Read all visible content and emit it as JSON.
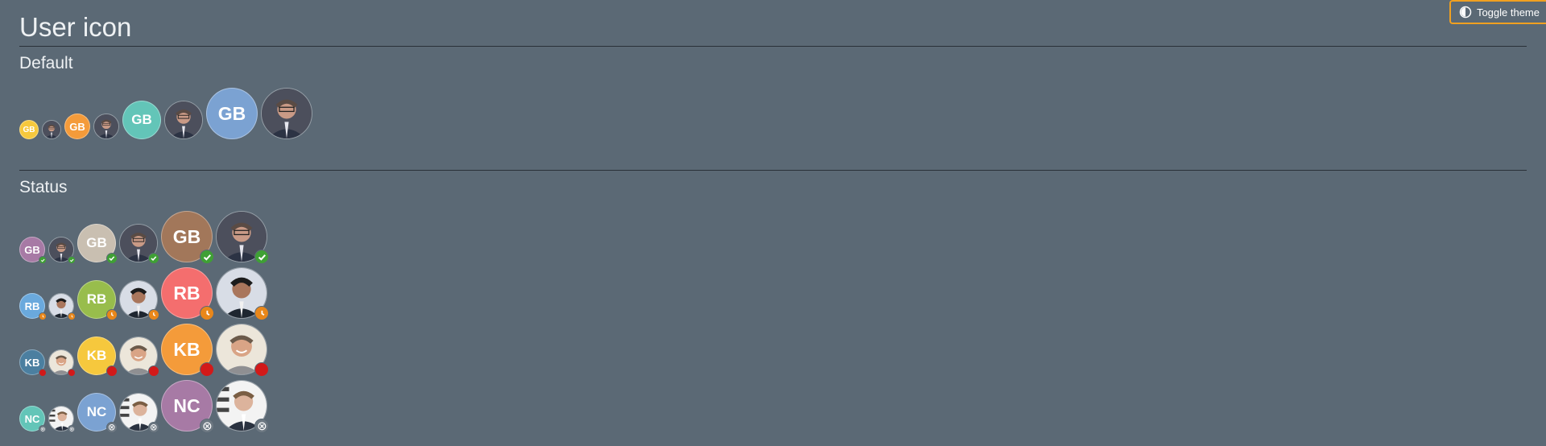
{
  "toggle": {
    "label": "Toggle theme",
    "icon": "theme-icon"
  },
  "title": "User icon",
  "sections": {
    "default": {
      "title": "Default"
    },
    "status": {
      "title": "Status"
    }
  },
  "avatars": {
    "gb": "GB",
    "rb": "RB",
    "kb": "KB",
    "nc": "NC"
  },
  "colors": {
    "yellow": "#f6c83d",
    "orange": "#f49b3a",
    "teal": "#63c5b8",
    "blue": "#7ba2d2",
    "purple": "#a77aa5",
    "beige": "#c9bfb1",
    "brown": "#a2775a",
    "lightblue": "#6aa9dd",
    "green": "#98bd4c",
    "red": "#f46e6e",
    "steel": "#4b7fa0",
    "accent": "#f0a020"
  },
  "statuses": [
    "available",
    "away",
    "busy",
    "offline"
  ]
}
